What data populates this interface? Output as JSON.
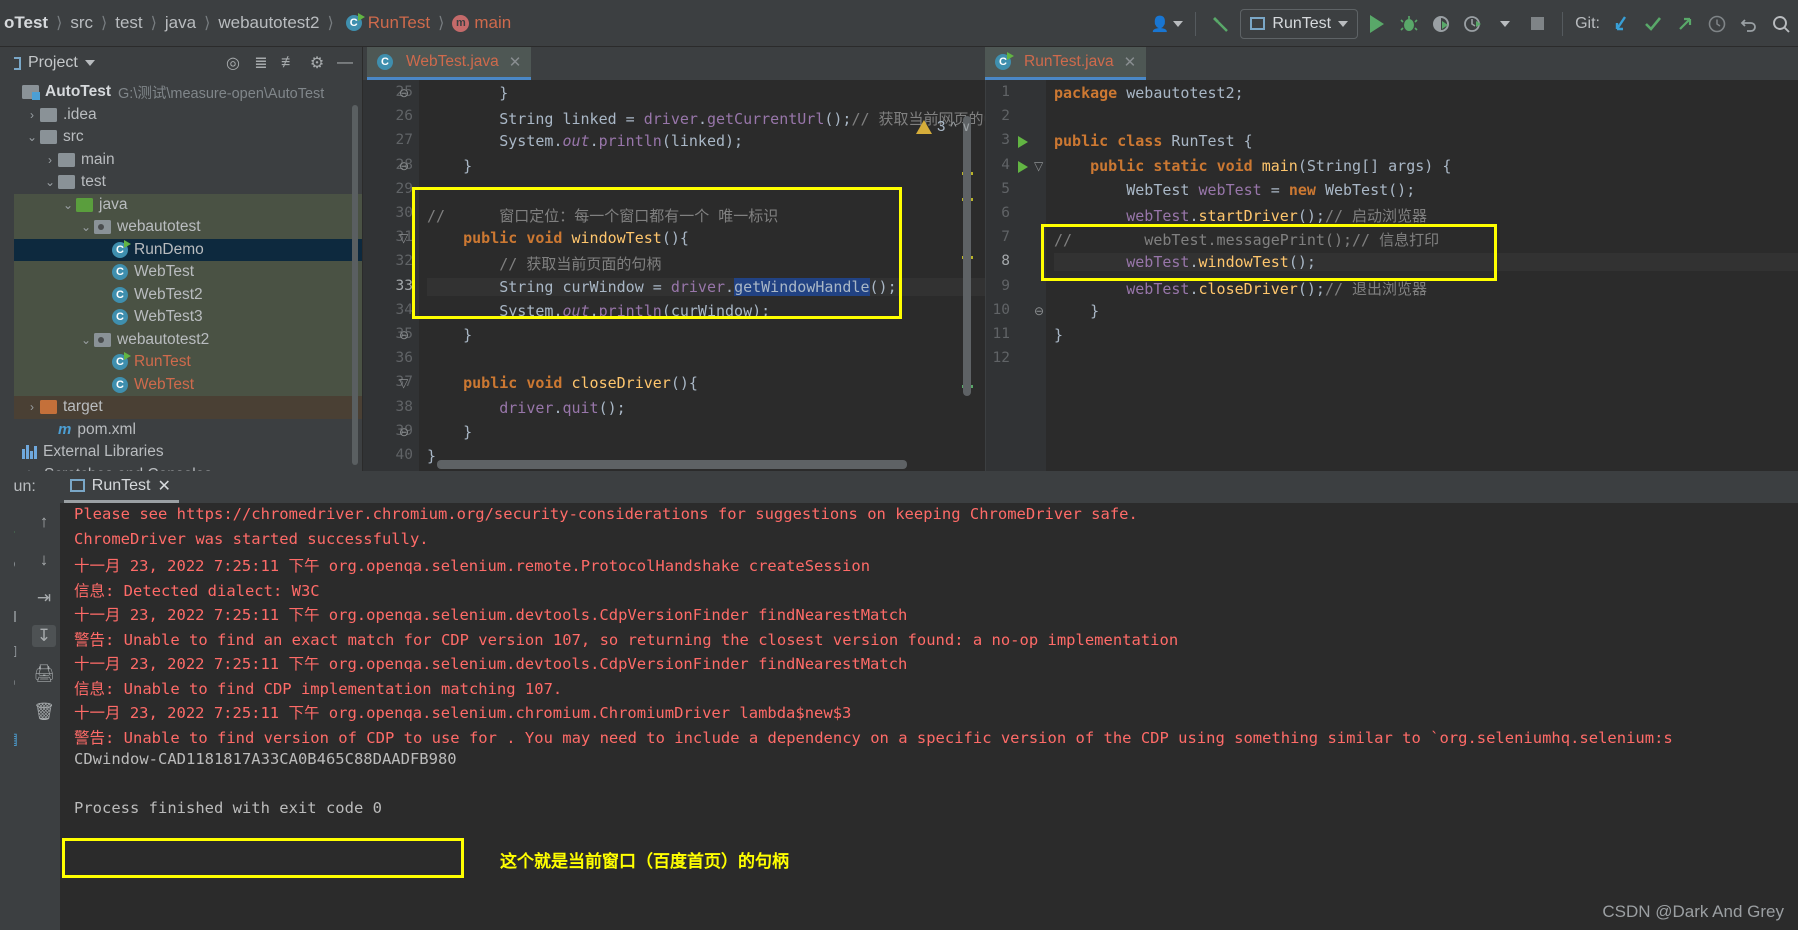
{
  "breadcrumb": {
    "items": [
      {
        "label": "oTest",
        "style": "bold"
      },
      {
        "label": "src",
        "style": "normal"
      },
      {
        "label": "test",
        "style": "normal"
      },
      {
        "label": "java",
        "style": "normal"
      },
      {
        "label": "webautotest2",
        "style": "normal"
      },
      {
        "label": "RunTest",
        "style": "red"
      },
      {
        "label": "main",
        "style": "red"
      }
    ],
    "separator": "〉"
  },
  "toolbar": {
    "avatar_icon": "user-icon",
    "hammer_icon": "build-icon",
    "run_config_label": "RunTest",
    "run_icon": "run-icon",
    "debug_icon": "debug-icon",
    "coverage_icon": "run-with-coverage-icon",
    "profile_icon": "profiler-icon",
    "stop_icon": "stop-icon",
    "git_label": "Git:",
    "update_icon": "git-update-icon",
    "commit_icon": "git-commit-icon",
    "push_icon": "git-push-icon",
    "history_icon": "history-icon",
    "undo_icon": "undo-icon",
    "search_icon": "search-icon"
  },
  "project_panel": {
    "title": "Project",
    "icons": [
      "locate-icon",
      "expand-all-icon",
      "collapse-all-icon",
      "gear-icon",
      "hide-icon"
    ],
    "tree": [
      {
        "indent": 0,
        "arrow": "",
        "icon": "module-folder",
        "label": "AutoTest",
        "style": "bold",
        "path": "G:\\测试\\measure-open\\AutoTest",
        "row": "normal"
      },
      {
        "indent": 1,
        "arrow": "›",
        "icon": "folder",
        "label": ".idea",
        "style": "normal",
        "path": "",
        "row": "normal"
      },
      {
        "indent": 1,
        "arrow": "⌄",
        "icon": "folder",
        "label": "src",
        "style": "normal",
        "path": "",
        "row": "normal"
      },
      {
        "indent": 2,
        "arrow": "›",
        "icon": "folder",
        "label": "main",
        "style": "normal",
        "path": "",
        "row": "normal"
      },
      {
        "indent": 2,
        "arrow": "⌄",
        "icon": "folder",
        "label": "test",
        "style": "normal",
        "path": "",
        "row": "normal"
      },
      {
        "indent": 3,
        "arrow": "⌄",
        "icon": "folder-green",
        "label": "java",
        "style": "normal",
        "path": "",
        "row": "green"
      },
      {
        "indent": 4,
        "arrow": "⌄",
        "icon": "package",
        "label": "webautotest",
        "style": "normal",
        "path": "",
        "row": "green"
      },
      {
        "indent": 5,
        "arrow": "",
        "icon": "class-runnable",
        "label": "RunDemo",
        "style": "normal",
        "path": "",
        "row": "selected"
      },
      {
        "indent": 5,
        "arrow": "",
        "icon": "class",
        "label": "WebTest",
        "style": "normal",
        "path": "",
        "row": "green"
      },
      {
        "indent": 5,
        "arrow": "",
        "icon": "class",
        "label": "WebTest2",
        "style": "normal",
        "path": "",
        "row": "green"
      },
      {
        "indent": 5,
        "arrow": "",
        "icon": "class",
        "label": "WebTest3",
        "style": "normal",
        "path": "",
        "row": "green"
      },
      {
        "indent": 4,
        "arrow": "⌄",
        "icon": "package",
        "label": "webautotest2",
        "style": "normal",
        "path": "",
        "row": "green"
      },
      {
        "indent": 5,
        "arrow": "",
        "icon": "class-runnable",
        "label": "RunTest",
        "style": "red",
        "path": "",
        "row": "green"
      },
      {
        "indent": 5,
        "arrow": "",
        "icon": "class",
        "label": "WebTest",
        "style": "red",
        "path": "",
        "row": "green"
      },
      {
        "indent": 1,
        "arrow": "›",
        "icon": "folder-orange",
        "label": "target",
        "style": "normal",
        "path": "",
        "row": "brown"
      },
      {
        "indent": 2,
        "arrow": "",
        "icon": "maven",
        "label": "pom.xml",
        "style": "normal",
        "path": "",
        "row": "normal"
      },
      {
        "indent": 0,
        "arrow": "",
        "icon": "libraries",
        "label": "External Libraries",
        "style": "normal",
        "path": "",
        "row": "normal"
      },
      {
        "indent": 0,
        "arrow": "",
        "icon": "scratches",
        "label": "Scratches and Consoles",
        "style": "normal",
        "path": "",
        "row": "normal"
      }
    ]
  },
  "editor_left": {
    "tab_label": "WebTest.java",
    "tab_icon": "java-class-icon",
    "warning_count": "3",
    "warning_icon": "warning-triangle-icon",
    "lines": [
      {
        "n": "25",
        "fold": "end",
        "text": "        }"
      },
      {
        "n": "26",
        "fold": "",
        "text": "        String linked = driver.getCurrentUrl();// 获取当前网页的url"
      },
      {
        "n": "27",
        "fold": "",
        "text": "        System.out.println(linked);"
      },
      {
        "n": "28",
        "fold": "end",
        "text": "    }"
      },
      {
        "n": "29",
        "fold": "",
        "text": ""
      },
      {
        "n": "30",
        "fold": "",
        "text": "//      窗口定位：每一个窗口都有一个 唯一标识"
      },
      {
        "n": "31",
        "fold": "start",
        "text": "    public void windowTest(){"
      },
      {
        "n": "32",
        "fold": "",
        "text": "        // 获取当前页面的句柄"
      },
      {
        "n": "33",
        "fold": "",
        "text": "        String curWindow = driver.getWindowHandle();"
      },
      {
        "n": "34",
        "fold": "",
        "text": "        System.out.println(curWindow);"
      },
      {
        "n": "35",
        "fold": "end",
        "text": "    }"
      },
      {
        "n": "36",
        "fold": "",
        "text": ""
      },
      {
        "n": "37",
        "fold": "start",
        "text": "    public void closeDriver(){"
      },
      {
        "n": "38",
        "fold": "",
        "text": "        driver.quit();"
      },
      {
        "n": "39",
        "fold": "end",
        "text": "    }"
      },
      {
        "n": "40",
        "fold": "",
        "text": "}"
      }
    ],
    "selected_token": "getWindowHandle"
  },
  "editor_right": {
    "tab_label": "RunTest.java",
    "tab_icon": "java-class-icon",
    "lines": [
      {
        "n": "1",
        "gutter": "",
        "text": "package webautotest2;"
      },
      {
        "n": "2",
        "gutter": "",
        "text": ""
      },
      {
        "n": "3",
        "gutter": "run",
        "text": "public class RunTest {"
      },
      {
        "n": "4",
        "gutter": "run",
        "text": "    public static void main(String[] args) {"
      },
      {
        "n": "5",
        "gutter": "",
        "text": "        WebTest webTest = new WebTest();"
      },
      {
        "n": "6",
        "gutter": "",
        "text": "        webTest.startDriver();// 启动浏览器"
      },
      {
        "n": "7",
        "gutter": "",
        "text": "//        webTest.messagePrint();// 信息打印"
      },
      {
        "n": "8",
        "gutter": "",
        "text": "        webTest.windowTest();"
      },
      {
        "n": "9",
        "gutter": "",
        "text": "        webTest.closeDriver();// 退出浏览器"
      },
      {
        "n": "10",
        "gutter": "",
        "text": "    }"
      },
      {
        "n": "11",
        "gutter": "",
        "text": "}"
      },
      {
        "n": "12",
        "gutter": "",
        "text": ""
      }
    ]
  },
  "run_panel": {
    "label": "Run:",
    "tab_label": "RunTest",
    "tab_icon": "run-config-icon",
    "side_icons": [
      "rerun-icon",
      "up-arrow-icon",
      "down-arrow-icon",
      "soft-wrap-icon",
      "scroll-to-end-icon",
      "print-icon",
      "trash-icon"
    ],
    "console_lines": [
      {
        "type": "err",
        "text": "Please see ",
        "link": "https://chromedriver.chromium.org/security-considerations",
        "suffix": " for suggestions on keeping ChromeDriver safe."
      },
      {
        "type": "err",
        "text": "ChromeDriver was started successfully."
      },
      {
        "type": "err",
        "text": "十一月 23, 2022 7:25:11 下午 org.openqa.selenium.remote.ProtocolHandshake createSession"
      },
      {
        "type": "err",
        "text": "信息: Detected dialect: W3C"
      },
      {
        "type": "err",
        "text": "十一月 23, 2022 7:25:11 下午 org.openqa.selenium.devtools.CdpVersionFinder findNearestMatch"
      },
      {
        "type": "err",
        "text": "警告: Unable to find an exact match for CDP version 107, so returning the closest version found: a no-op implementation"
      },
      {
        "type": "err",
        "text": "十一月 23, 2022 7:25:11 下午 org.openqa.selenium.devtools.CdpVersionFinder findNearestMatch"
      },
      {
        "type": "err",
        "text": "信息: Unable to find CDP implementation matching 107."
      },
      {
        "type": "err",
        "text": "十一月 23, 2022 7:25:11 下午 org.openqa.selenium.chromium.ChromiumDriver lambda$new$3"
      },
      {
        "type": "err",
        "text": "警告: Unable to find version of CDP to use for . You may need to include a dependency on a specific version of the CDP using something similar to `org.seleniumhq.selenium:s"
      },
      {
        "type": "out",
        "text": "CDwindow-CAD1181817A33CA0B465C88DAADFB980"
      },
      {
        "type": "out",
        "text": ""
      },
      {
        "type": "out",
        "text": "Process finished with exit code 0"
      }
    ],
    "annotation": "这个就是当前窗口（百度首页）的句柄"
  },
  "watermark": "CSDN @Dark And Grey",
  "colors": {
    "highlight_yellow": "#ffff00",
    "accent_blue": "#4a88c7",
    "run_green": "#59a869",
    "error_red": "#ff6b68",
    "string_green": "#6a8759",
    "keyword_orange": "#cc7832",
    "method_yellow": "#ffc66d",
    "field_purple": "#9876aa"
  }
}
